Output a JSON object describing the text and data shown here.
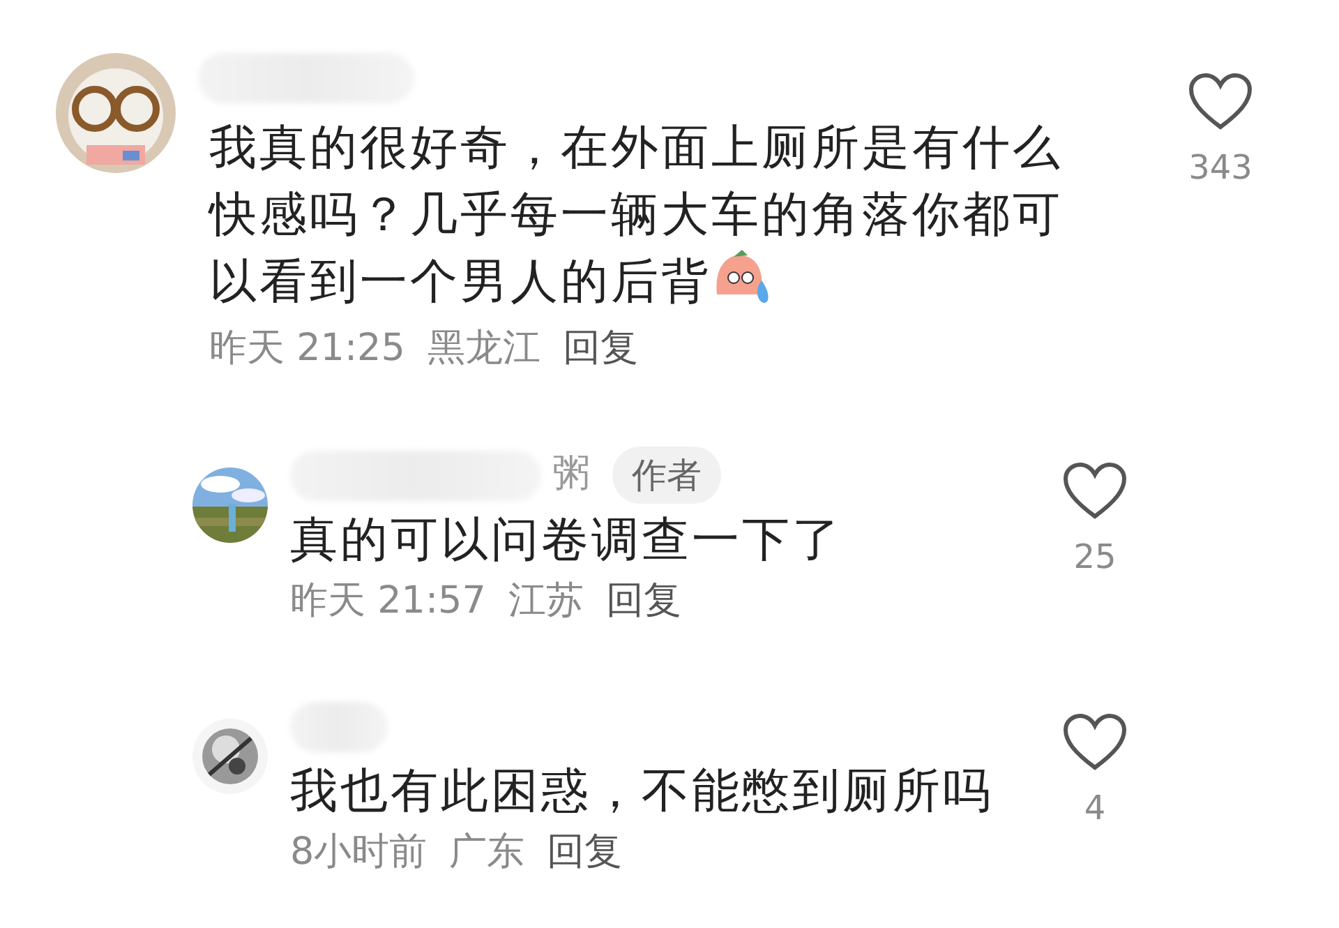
{
  "comments": [
    {
      "text": "我真的很好奇，在外面上厕所是有什么快感吗？几乎每一辆大车的角落你都可以看到一个男人的后背",
      "has_emoji": true,
      "time": "昨天 21:25",
      "location": "黑龙江",
      "reply_label": "回复",
      "likes": "343",
      "replies": [
        {
          "name_tail": "粥",
          "author_badge": "作者",
          "text": "真的可以问卷调查一下了",
          "time": "昨天 21:57",
          "location": "江苏",
          "reply_label": "回复",
          "likes": "25"
        },
        {
          "text": "我也有此困惑，不能憋到厕所吗",
          "time": "8小时前",
          "location": "广东",
          "reply_label": "回复",
          "likes": "4"
        }
      ]
    }
  ]
}
